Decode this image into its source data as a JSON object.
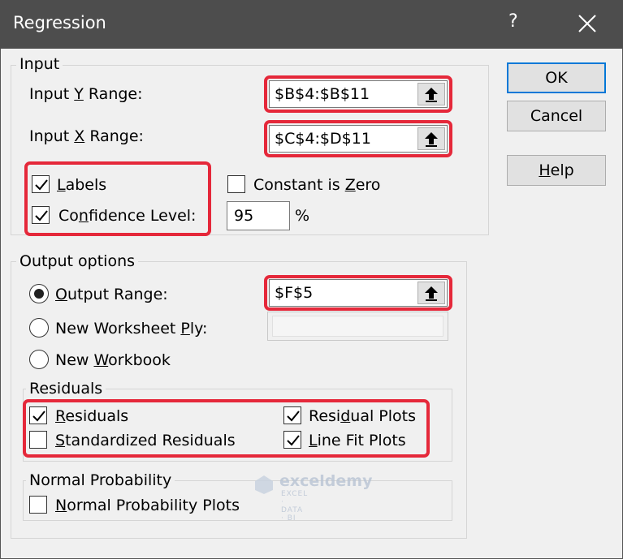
{
  "window": {
    "title": "Regression",
    "help_glyph": "?"
  },
  "input": {
    "legend": "Input",
    "y_range": {
      "label_pre": "Input ",
      "label_key": "Y",
      "label_post": " Range:",
      "value": "$B$4:$B$11"
    },
    "x_range": {
      "label_pre": "Input ",
      "label_key": "X",
      "label_post": " Range:",
      "value": "$C$4:$D$11"
    },
    "labels": {
      "key": "L",
      "rest": "abels",
      "checked": true
    },
    "constant_zero": {
      "pre": "Constant is ",
      "key": "Z",
      "post": "ero",
      "checked": false
    },
    "confidence": {
      "pre": "Co",
      "key": "n",
      "post": "fidence Level:",
      "checked": true,
      "value": "95",
      "unit": "%"
    }
  },
  "output": {
    "legend": "Output options",
    "output_range": {
      "key": "O",
      "rest": "utput Range:",
      "selected": true,
      "value": "$F$5"
    },
    "new_ply": {
      "pre": "New Worksheet ",
      "key": "P",
      "post": "ly:",
      "selected": false
    },
    "new_workbook": {
      "pre": "New ",
      "key": "W",
      "post": "orkbook",
      "selected": false
    }
  },
  "residuals": {
    "legend": "Residuals",
    "residuals": {
      "key": "R",
      "rest": "esiduals",
      "checked": true
    },
    "standardized": {
      "key": "S",
      "rest": "tandardized Residuals",
      "checked": false
    },
    "residual_plots": {
      "pre": "Resi",
      "key": "d",
      "post": "ual Plots",
      "checked": true
    },
    "line_fit": {
      "key": "L",
      "rest": "ine Fit Plots",
      "checked": true
    }
  },
  "normal": {
    "legend": "Normal Probability",
    "plots": {
      "key": "N",
      "rest": "ormal Probability Plots",
      "checked": false
    }
  },
  "buttons": {
    "ok": "OK",
    "cancel": "Cancel",
    "help": {
      "key": "H",
      "rest": "elp"
    }
  },
  "watermark": {
    "name": "exceldemy",
    "tagline": "EXCEL · DATA · BI"
  },
  "colors": {
    "highlight": "#e5283a",
    "titlebar": "#4d4d4d",
    "default_button_border": "#0078d7"
  }
}
